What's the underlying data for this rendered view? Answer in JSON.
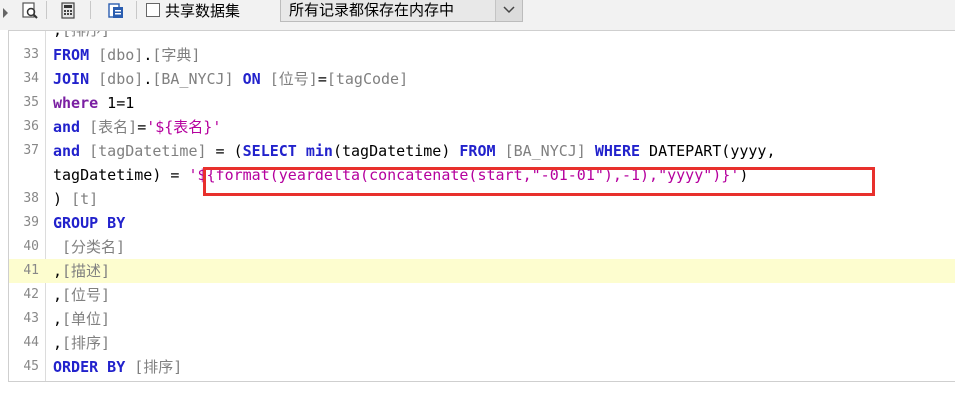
{
  "toolbar": {
    "share_dataset_label": "共享数据集",
    "memory_mode_value": "所有记录都保存在内存中",
    "icons": [
      "preview-icon",
      "calculator-icon",
      "export-icon"
    ]
  },
  "editor": {
    "lines": [
      {
        "num": "33",
        "tokens": [
          [
            "kw",
            "FROM"
          ],
          [
            "tx",
            " "
          ],
          [
            "br",
            "[dbo]"
          ],
          [
            "tx",
            "."
          ],
          [
            "br",
            "[字典]"
          ]
        ]
      },
      {
        "num": "34",
        "tokens": [
          [
            "kw",
            "JOIN"
          ],
          [
            "tx",
            " "
          ],
          [
            "br",
            "[dbo]"
          ],
          [
            "tx",
            "."
          ],
          [
            "br",
            "[BA_NYCJ]"
          ],
          [
            "tx",
            " "
          ],
          [
            "kw",
            "ON"
          ],
          [
            "tx",
            " "
          ],
          [
            "br",
            "[位号]"
          ],
          [
            "tx",
            "="
          ],
          [
            "br",
            "[tagCode]"
          ]
        ]
      },
      {
        "num": "35",
        "tokens": [
          [
            "kw2",
            "where"
          ],
          [
            "tx",
            " 1=1"
          ]
        ]
      },
      {
        "num": "36",
        "tokens": [
          [
            "kw",
            "and"
          ],
          [
            "tx",
            " "
          ],
          [
            "br",
            "[表名]"
          ],
          [
            "tx",
            "="
          ],
          [
            "st",
            "'${表名}'"
          ]
        ]
      },
      {
        "num": "37",
        "tokens": [
          [
            "kw",
            "and"
          ],
          [
            "tx",
            " "
          ],
          [
            "br",
            "[tagDatetime]"
          ],
          [
            "tx",
            " = ("
          ],
          [
            "kw",
            "SELECT"
          ],
          [
            "tx",
            " "
          ],
          [
            "kw",
            "min"
          ],
          [
            "tx",
            "(tagDatetime) "
          ],
          [
            "kw",
            "FROM"
          ],
          [
            "tx",
            " "
          ],
          [
            "br",
            "[BA_NYCJ]"
          ],
          [
            "tx",
            " "
          ],
          [
            "kw",
            "WHERE"
          ],
          [
            "tx",
            " DATEPART(yyyy,"
          ]
        ]
      },
      {
        "num": "",
        "tokens": [
          [
            "tx",
            "tagDatetime) = "
          ],
          [
            "st",
            "'${format(yeardelta(concatenate(start,\"-01-01\"),-1),\"yyyy\")}'"
          ],
          [
            "tx",
            ")"
          ]
        ]
      },
      {
        "num": "38",
        "tokens": [
          [
            "tx",
            ") "
          ],
          [
            "br",
            "[t]"
          ]
        ]
      },
      {
        "num": "39",
        "tokens": [
          [
            "kw",
            "GROUP BY"
          ]
        ]
      },
      {
        "num": "40",
        "tokens": [
          [
            "tx",
            " "
          ],
          [
            "br",
            "[分类名]"
          ]
        ]
      },
      {
        "num": "41",
        "hl": true,
        "tokens": [
          [
            "tx",
            ","
          ],
          [
            "br",
            "[描述]"
          ]
        ]
      },
      {
        "num": "42",
        "tokens": [
          [
            "tx",
            ","
          ],
          [
            "br",
            "[位号]"
          ]
        ]
      },
      {
        "num": "43",
        "tokens": [
          [
            "tx",
            ","
          ],
          [
            "br",
            "[单位]"
          ]
        ]
      },
      {
        "num": "44",
        "tokens": [
          [
            "tx",
            ","
          ],
          [
            "br",
            "[排序]"
          ]
        ]
      },
      {
        "num": "45",
        "tokens": [
          [
            "kw",
            "ORDER BY"
          ],
          [
            "tx",
            " "
          ],
          [
            "br",
            "[排序]"
          ]
        ]
      }
    ]
  }
}
